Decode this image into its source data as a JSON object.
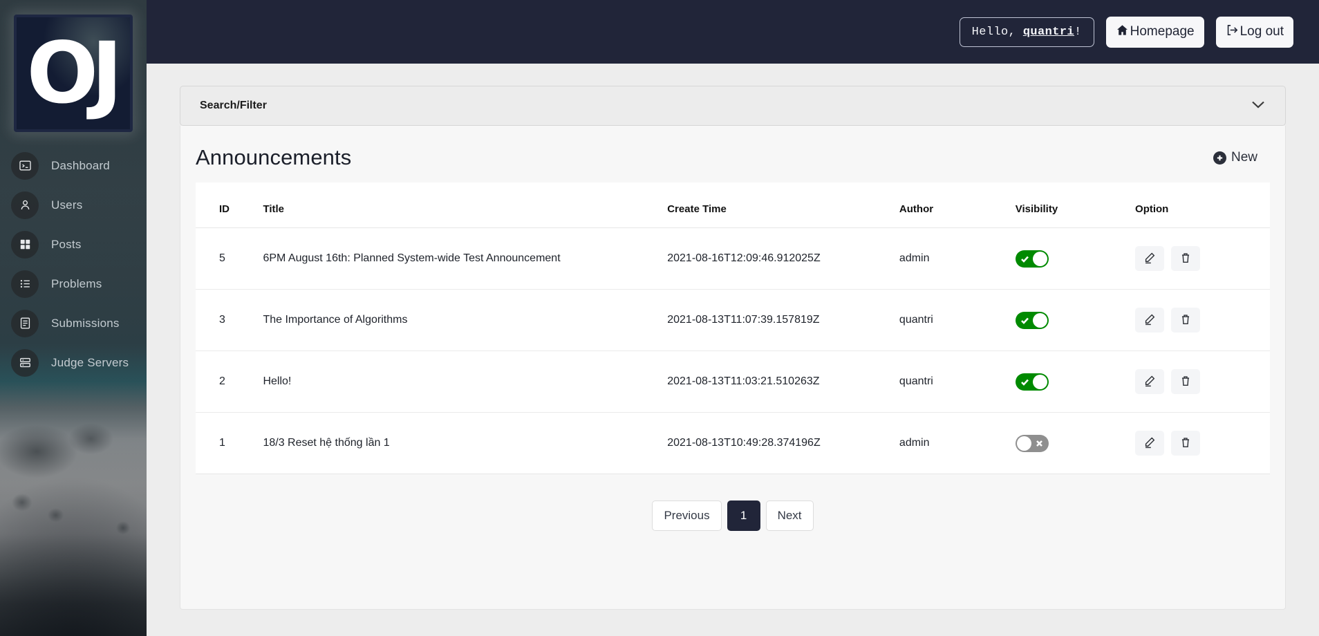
{
  "sidebar": {
    "logo_text": "OJ",
    "logo_name": "oj-logo",
    "items": [
      {
        "label": "Dashboard",
        "icon": "terminal-icon"
      },
      {
        "label": "Users",
        "icon": "user-icon"
      },
      {
        "label": "Posts",
        "icon": "grid-icon"
      },
      {
        "label": "Problems",
        "icon": "list-icon"
      },
      {
        "label": "Submissions",
        "icon": "document-icon"
      },
      {
        "label": "Judge Servers",
        "icon": "server-icon"
      }
    ]
  },
  "topbar": {
    "greeting_prefix": "Hello, ",
    "username": "quantri",
    "greeting_suffix": "!",
    "homepage_label": "Homepage",
    "logout_label": "Log out",
    "background_color": "#212539"
  },
  "search_filter": {
    "title": "Search/Filter",
    "expanded": false,
    "chevron": "chevron-down-icon"
  },
  "announcements": {
    "title": "Announcements",
    "new_label": "New",
    "columns": [
      "ID",
      "Title",
      "Create Time",
      "Author",
      "Visibility",
      "Option"
    ],
    "rows": [
      {
        "id": "5",
        "title": "6PM August 16th: Planned System-wide Test Announcement",
        "create_time": "2021-08-16T12:09:46.912025Z",
        "author": "admin",
        "visible": true
      },
      {
        "id": "3",
        "title": "The Importance of Algorithms",
        "create_time": "2021-08-13T11:07:39.157819Z",
        "author": "quantri",
        "visible": true
      },
      {
        "id": "2",
        "title": "Hello!",
        "create_time": "2021-08-13T11:03:21.510263Z",
        "author": "quantri",
        "visible": true
      },
      {
        "id": "1",
        "title": "18/3 Reset hệ thống lần 1",
        "create_time": "2021-08-13T10:49:28.374196Z",
        "author": "admin",
        "visible": false
      }
    ],
    "edit_icon": "pencil-icon",
    "delete_icon": "trash-icon",
    "toggle_on_color": "#008a00",
    "toggle_off_color": "#8f8f8f"
  },
  "pagination": {
    "previous_label": "Previous",
    "next_label": "Next",
    "pages": [
      "1"
    ],
    "current_page": "1",
    "active_color": "#212539"
  }
}
